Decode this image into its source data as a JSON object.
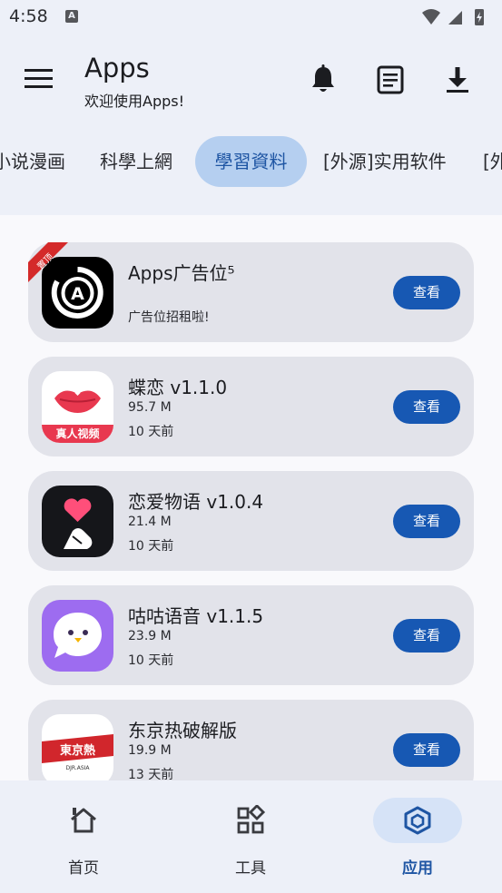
{
  "status_bar": {
    "time": "4:58",
    "notification_glyph": "A"
  },
  "app_bar": {
    "title": "Apps",
    "subtitle": "欢迎使用Apps!"
  },
  "tabs": [
    {
      "label": "小说漫画"
    },
    {
      "label": "科學上網"
    },
    {
      "label": "學習資料",
      "active": true
    },
    {
      "label": "[外源]实用软件"
    },
    {
      "label": "[外源]"
    }
  ],
  "apps": [
    {
      "name": "Apps广告位⁵",
      "size": "",
      "time": "广告位招租啦!",
      "badge": "置顶",
      "icon": "apps-logo-icon",
      "action": "查看"
    },
    {
      "name": "蝶恋 v1.1.0",
      "size": "95.7 M",
      "time": "10 天前",
      "icon_caption": "真人视频",
      "icon": "lips-icon",
      "action": "查看"
    },
    {
      "name": "恋爱物语 v1.0.4",
      "size": "21.4 M",
      "time": "10 天前",
      "icon": "heart-hand-icon",
      "action": "查看"
    },
    {
      "name": "咕咕语音 v1.1.5",
      "size": "23.9 M",
      "time": "10 天前",
      "icon": "bird-bubble-icon",
      "action": "查看"
    },
    {
      "name": "东京热破解版",
      "size": "19.9 M",
      "time": "13 天前",
      "icon_caption": "東京熱",
      "icon_subcaption": "DJR.ASIA",
      "icon": "tokyo-banner-icon",
      "action": "查看"
    }
  ],
  "bottom_nav": [
    {
      "label": "首页",
      "icon": "home-icon"
    },
    {
      "label": "工具",
      "icon": "tools-grid-icon"
    },
    {
      "label": "应用",
      "icon": "apps-cube-icon",
      "active": true
    }
  ],
  "colors": {
    "accent": "#1758b3",
    "tab_active_bg": "#b5cff0",
    "card_bg": "#e2e3ea",
    "badge_red": "#d42a2a"
  }
}
